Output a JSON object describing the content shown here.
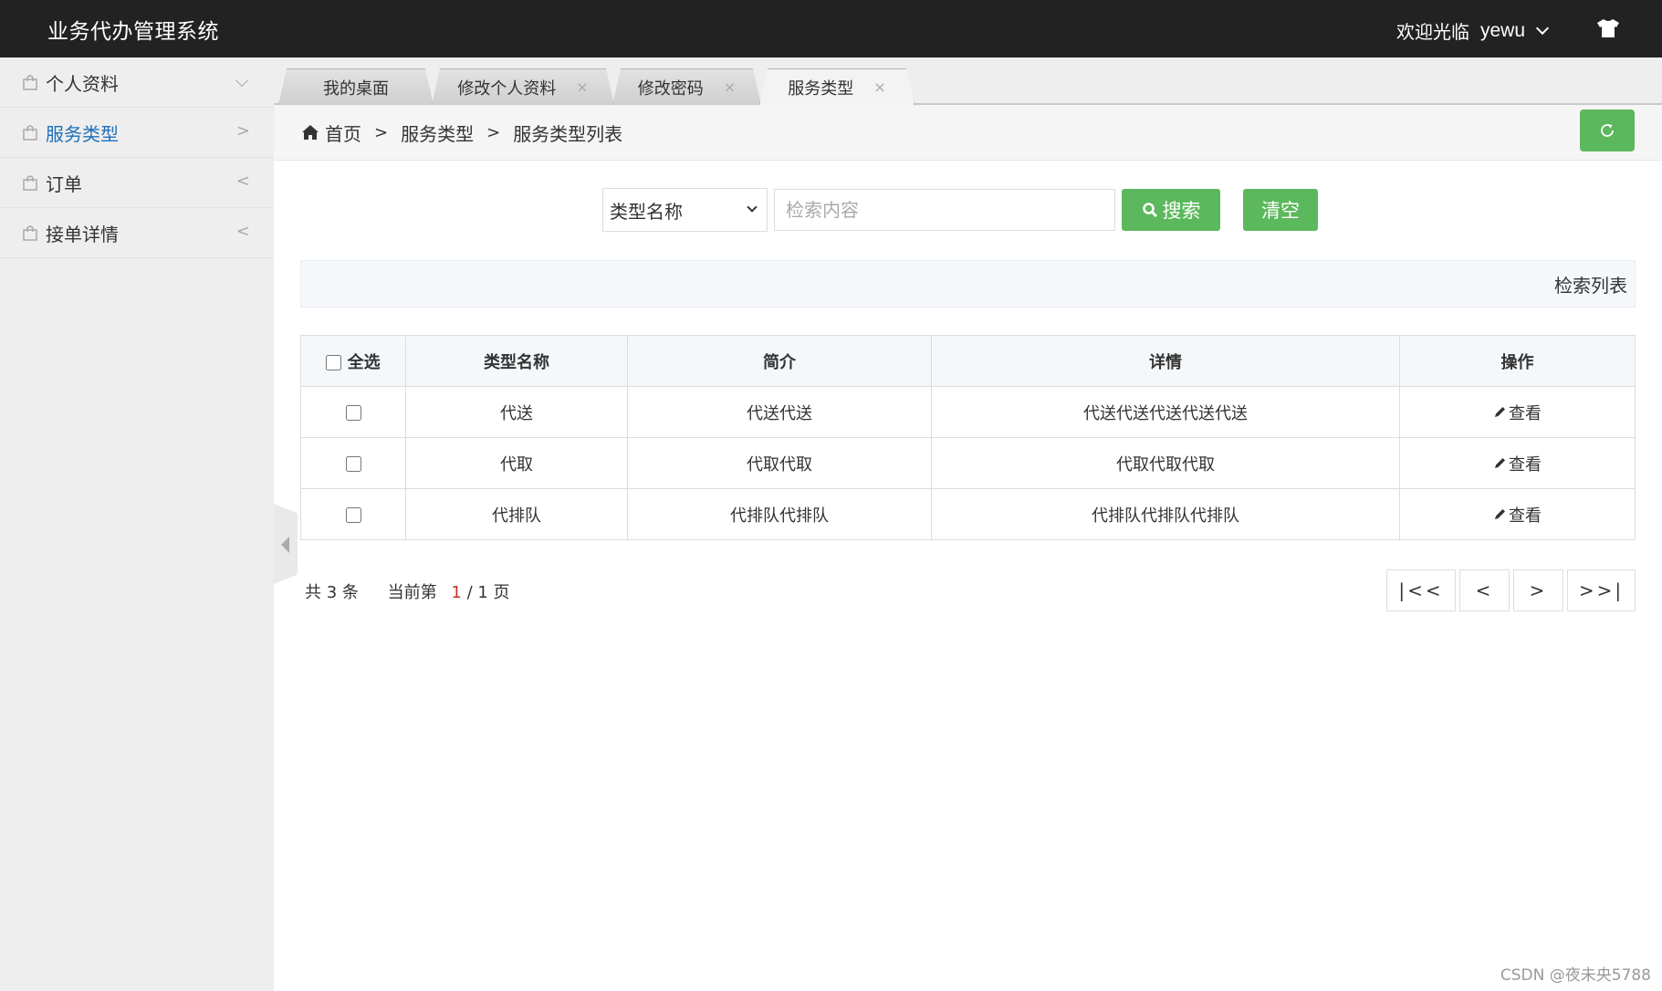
{
  "header": {
    "title": "业务代办管理系统",
    "welcome": "欢迎光临",
    "username": "yewu"
  },
  "sidebar": {
    "items": [
      {
        "label": "个人资料",
        "arrow": "down",
        "active": false
      },
      {
        "label": "服务类型",
        "arrow": ">",
        "active": true
      },
      {
        "label": "订单",
        "arrow": "<",
        "active": false
      },
      {
        "label": "接单详情",
        "arrow": "<",
        "active": false
      }
    ]
  },
  "tabs": [
    {
      "label": "我的桌面",
      "closable": false,
      "active": false
    },
    {
      "label": "修改个人资料",
      "closable": true,
      "active": false
    },
    {
      "label": "修改密码",
      "closable": true,
      "active": false
    },
    {
      "label": "服务类型",
      "closable": true,
      "active": true
    }
  ],
  "tab_close_glyph": "×",
  "breadcrumb": {
    "items": [
      "首页",
      "服务类型",
      "服务类型列表"
    ],
    "separator": ">"
  },
  "search": {
    "field_select": "类型名称",
    "placeholder": "检索内容",
    "value": "",
    "search_label": "搜索",
    "clear_label": "清空"
  },
  "list_title": "检索列表",
  "table": {
    "select_all_label": "全选",
    "columns": [
      "类型名称",
      "简介",
      "详情",
      "操作"
    ],
    "rows": [
      {
        "name": "代送",
        "intro": "代送代送",
        "detail": "代送代送代送代送代送",
        "action": "查看"
      },
      {
        "name": "代取",
        "intro": "代取代取",
        "detail": "代取代取代取",
        "action": "查看"
      },
      {
        "name": "代排队",
        "intro": "代排队代排队",
        "detail": "代排队代排队代排队",
        "action": "查看"
      }
    ]
  },
  "pagination": {
    "total_prefix": "共",
    "total": "3",
    "total_suffix": "条",
    "current_prefix": "当前第",
    "current": "1",
    "pages_text": "/ 1 页",
    "first": "|<<",
    "prev": "<",
    "next": ">",
    "last": ">>|"
  },
  "watermark": "CSDN @夜未央5788",
  "colors": {
    "header_bg": "#222222",
    "accent_green": "#5cb85c",
    "active_link": "#1e6fb8",
    "current_page": "#c9302c"
  }
}
